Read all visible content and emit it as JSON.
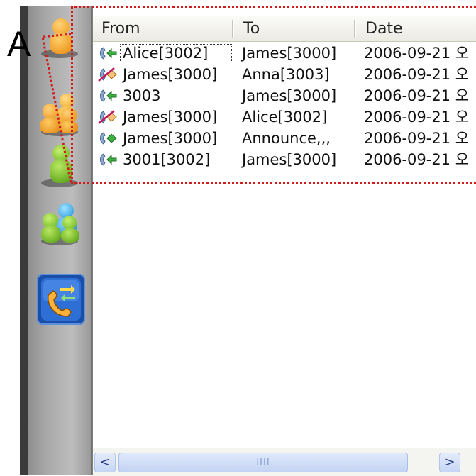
{
  "annotation": {
    "label": "A"
  },
  "sidebar": {
    "items": [
      {
        "name": "contact-person"
      },
      {
        "name": "group-people"
      },
      {
        "name": "green-person"
      },
      {
        "name": "multi-color-group"
      },
      {
        "name": "call-history",
        "selected": true
      }
    ]
  },
  "list": {
    "columns": [
      "From",
      "To",
      "Date"
    ],
    "rows": [
      {
        "type": "incoming",
        "from": "Alice[3002]",
        "to": "James[3000]",
        "date": "2006-09-21 오"
      },
      {
        "type": "missed",
        "from": "James[3000]",
        "to": "Anna[3003]",
        "date": "2006-09-21 오"
      },
      {
        "type": "incoming",
        "from": "3003",
        "to": "James[3000]",
        "date": "2006-09-21 오"
      },
      {
        "type": "missed",
        "from": "James[3000]",
        "to": "Alice[3002]",
        "date": "2006-09-21 오"
      },
      {
        "type": "incoming",
        "from": "James[3000]",
        "to": "Announce,,,",
        "date": "2006-09-21 오"
      },
      {
        "type": "incoming",
        "from": "3001[3002]",
        "to": "James[3000]",
        "date": "2006-09-21 오"
      }
    ]
  },
  "scrollbar": {
    "left_arrow": "<",
    "right_arrow": ">",
    "grip": "IIII"
  },
  "colors": {
    "annotation": "#d21a1a",
    "selected_tile": "#1f5fc4"
  }
}
